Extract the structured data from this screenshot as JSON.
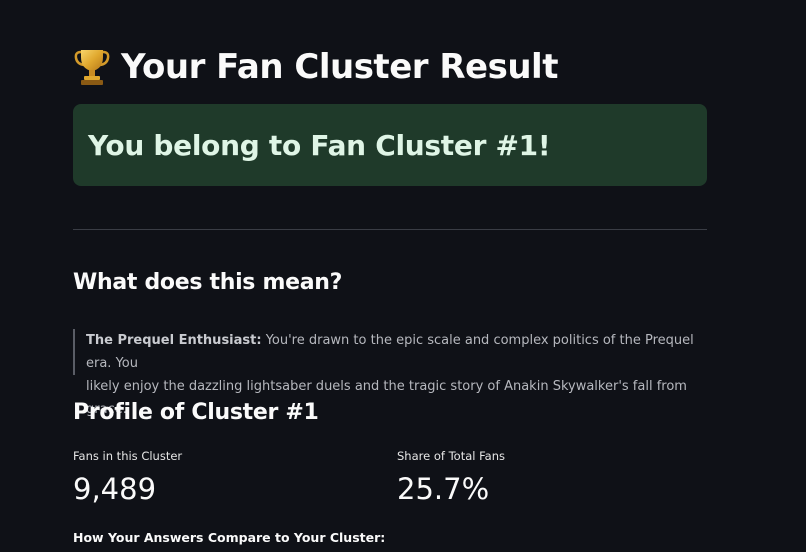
{
  "header": {
    "title": "Your Fan Cluster Result",
    "icon": "trophy-icon"
  },
  "result": {
    "message": "You belong to Fan Cluster #1!",
    "background": "#1f3a2a"
  },
  "meaning": {
    "heading": "What does this mean?",
    "label": "The Prequel Enthusiast:",
    "description_line1": " You're drawn to the epic scale and complex politics of the Prequel era. You",
    "description_line2": "likely enjoy the dazzling lightsaber duels and the tragic story of Anakin Skywalker's fall from grace."
  },
  "profile": {
    "heading": "Profile of Cluster #1",
    "metrics": [
      {
        "label": "Fans in this Cluster",
        "value": "9,489"
      },
      {
        "label": "Share of Total Fans",
        "value": "25.7%"
      }
    ],
    "compare_heading": "How Your Answers Compare to Your Cluster:"
  },
  "colors": {
    "background": "#0f1117",
    "text": "#fafafa",
    "success_bg": "#1f3a2a",
    "success_text": "#dff5e6",
    "muted": "#b6b8be"
  }
}
